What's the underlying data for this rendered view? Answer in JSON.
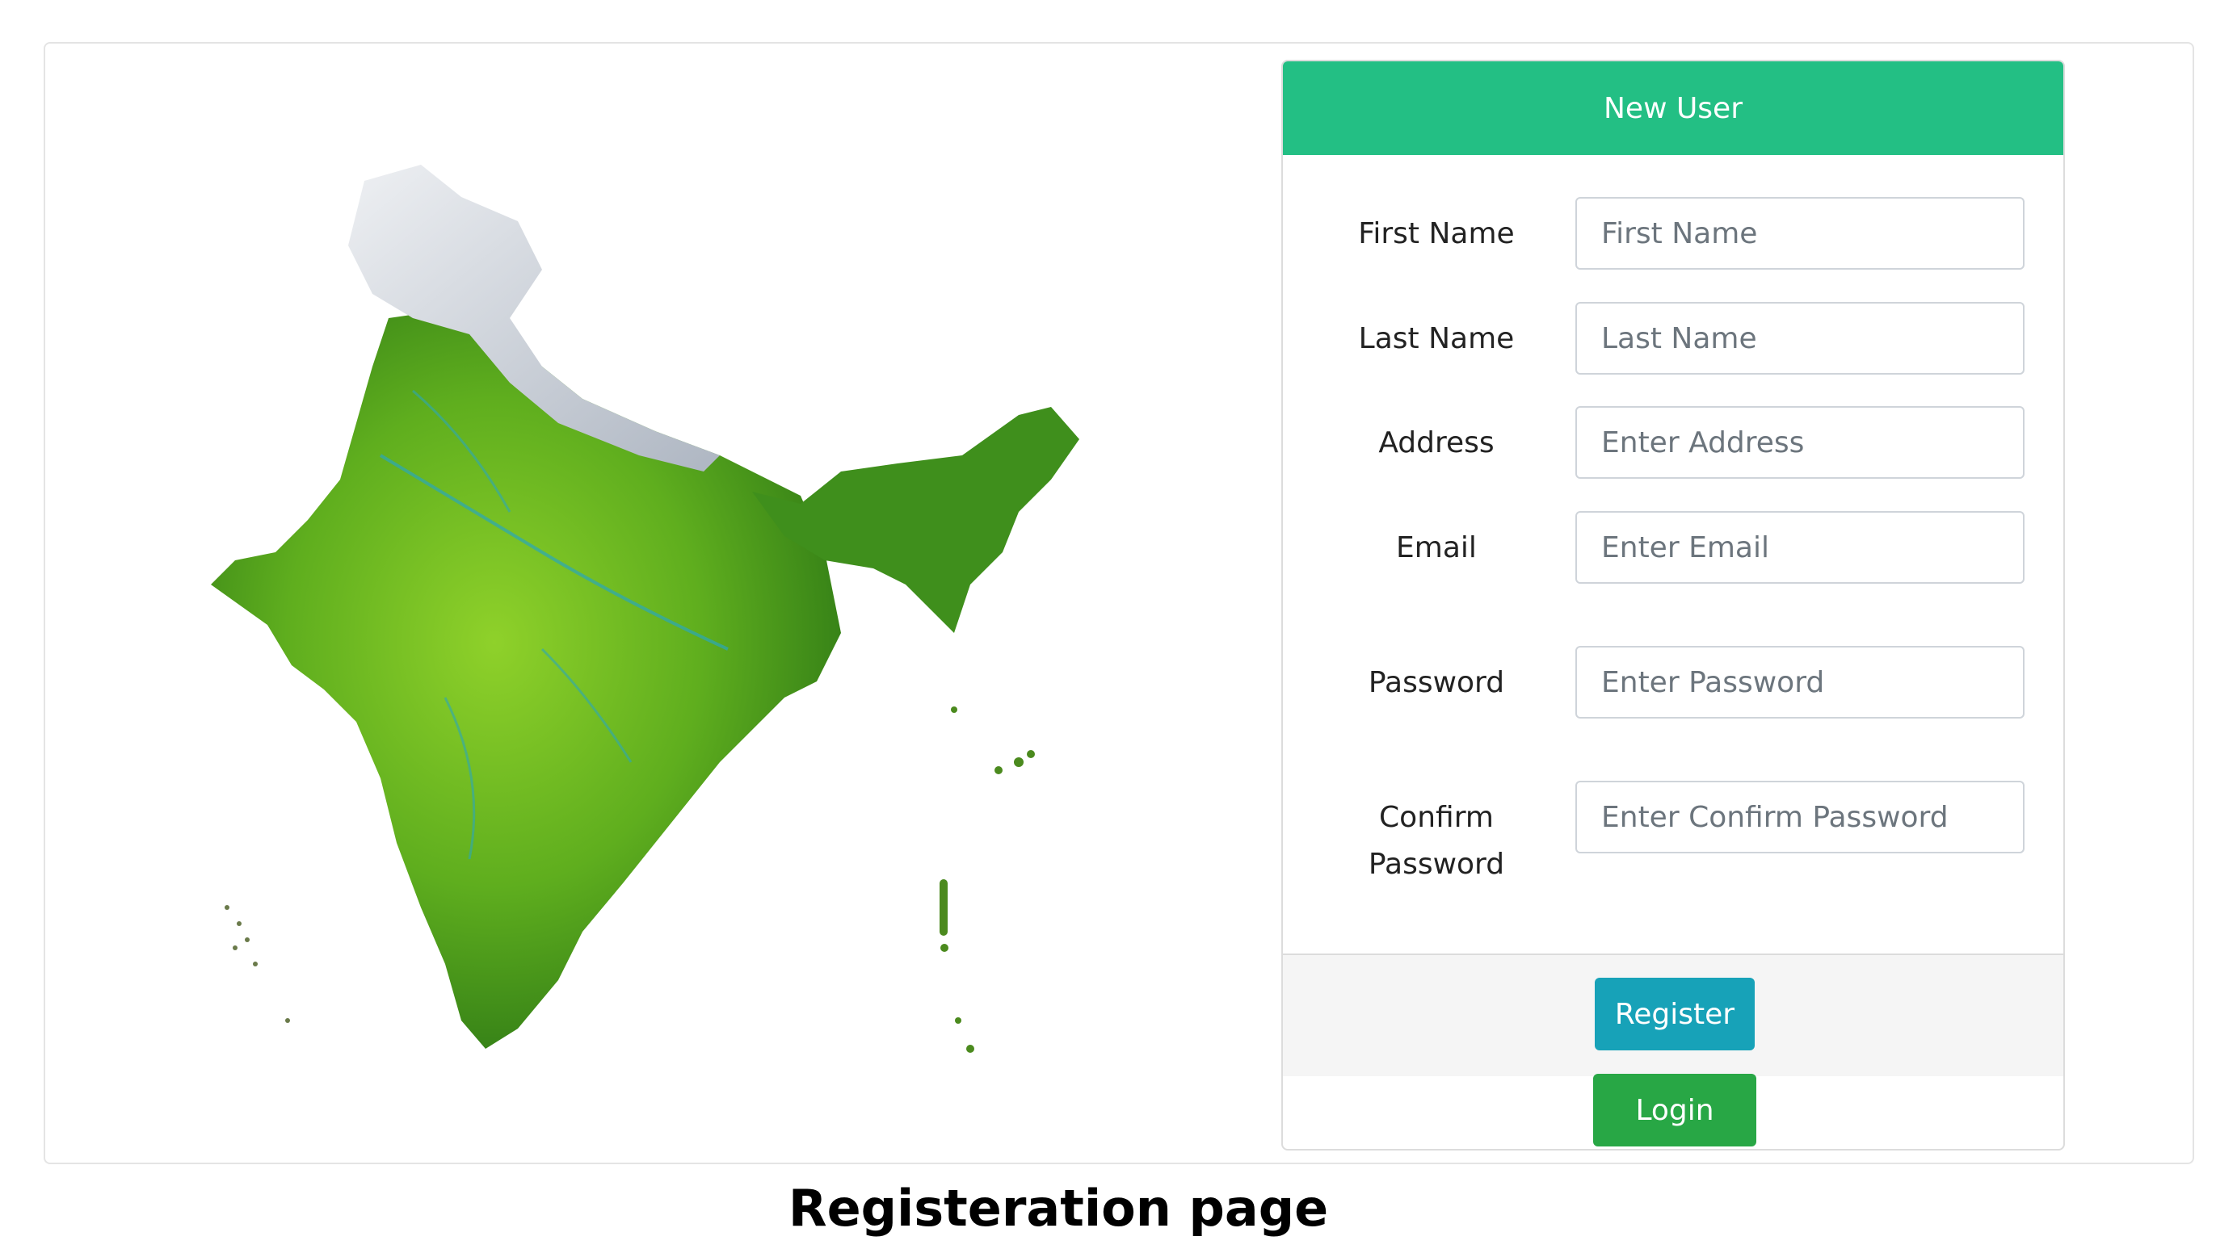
{
  "form": {
    "header_title": "New User",
    "fields": [
      {
        "label": "First Name",
        "placeholder": "First Name",
        "value": ""
      },
      {
        "label": "Last Name",
        "placeholder": "Last Name",
        "value": ""
      },
      {
        "label": "Address",
        "placeholder": "Enter Address",
        "value": ""
      },
      {
        "label": "Email",
        "placeholder": "Enter Email",
        "value": ""
      },
      {
        "label": "Password",
        "placeholder": "Enter Password",
        "value": ""
      },
      {
        "label_line1": "Confirm",
        "label_line2": "Password",
        "placeholder": "Enter Confirm Password",
        "value": ""
      }
    ],
    "register_label": "Register",
    "login_label": "Login"
  },
  "caption": "Registeration page",
  "map": {
    "icon": "india-map-image"
  },
  "colors": {
    "header_green": "#23bf84",
    "register_teal": "#17a2b8",
    "login_green": "#28a745",
    "map_green": "#5fae1e",
    "map_snow": "#d9dde2"
  }
}
